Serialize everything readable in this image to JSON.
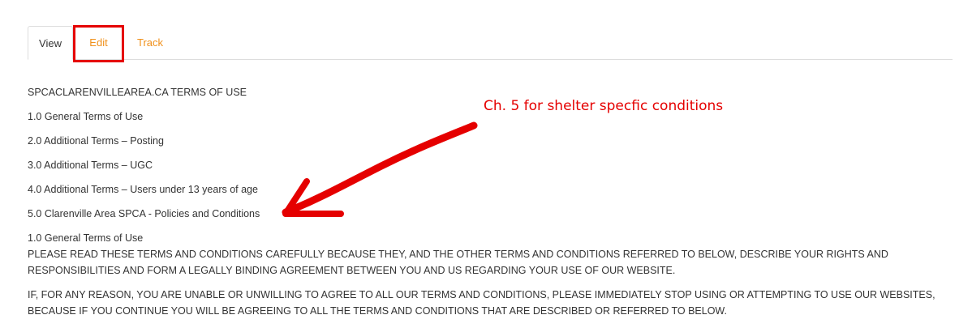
{
  "tabs": {
    "view_label": "View",
    "edit_label": "Edit",
    "track_label": "Track"
  },
  "content": {
    "title": "SPCACLARENVILLEAREA.CA TERMS OF USE",
    "toc": [
      "1.0 General Terms of Use",
      "2.0 Additional Terms – Posting",
      "3.0 Additional Terms – UGC",
      "4.0 Additional Terms – Users under 13 years of age",
      "5.0 Clarenville Area SPCA - Policies and Conditions"
    ],
    "section_heading": "1.0 General Terms of Use",
    "paragraph1": "PLEASE READ THESE TERMS AND CONDITIONS CAREFULLY BECAUSE THEY, AND THE OTHER TERMS AND CONDITIONS REFERRED TO BELOW, DESCRIBE YOUR RIGHTS AND RESPONSIBILITIES AND FORM A LEGALLY BINDING AGREEMENT BETWEEN YOU AND US REGARDING YOUR USE OF OUR WEBSITE.",
    "paragraph2": "IF, FOR ANY REASON, YOU ARE UNABLE OR UNWILLING TO AGREE TO ALL OUR TERMS AND CONDITIONS, PLEASE IMMEDIATELY STOP USING OR ATTEMPTING TO USE OUR WEBSITES, BECAUSE IF YOU CONTINUE YOU WILL BE AGREEING TO ALL THE TERMS AND CONDITIONS THAT ARE DESCRIBED OR REFERRED TO BELOW."
  },
  "annotation": {
    "text": "Ch. 5 for shelter specfic conditions",
    "color": "#e50000"
  },
  "colors": {
    "link": "#f0901a",
    "text": "#333333",
    "annotation": "#e50000"
  }
}
